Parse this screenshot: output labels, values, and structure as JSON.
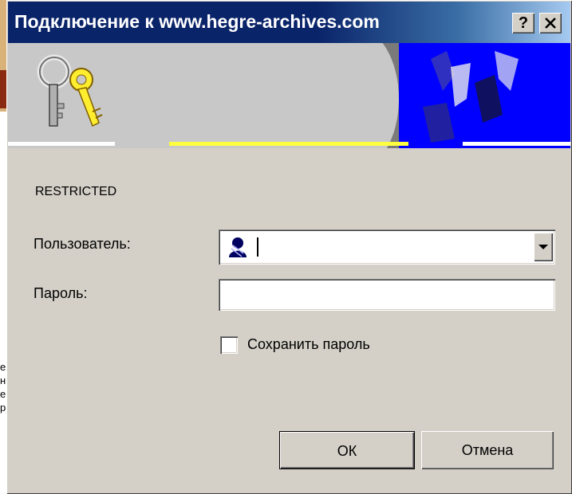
{
  "background_window": {
    "edge_letters": [
      "e",
      "н",
      "e",
      "р"
    ]
  },
  "dialog": {
    "title": "Подключение к www.hegre-archives.com",
    "help_button": "?",
    "close_button": "✕",
    "realm": "RESTRICTED",
    "user_label": "Пользователь:",
    "user_value": "",
    "password_label": "Пароль:",
    "password_value": "",
    "remember_label": "Сохранить пароль",
    "remember_checked": false,
    "ok_label": "ОК",
    "cancel_label": "Отмена"
  },
  "colors": {
    "titlebar": "#0a246a",
    "face": "#d4d0c8",
    "banner_blue": "#0000ff",
    "banner_yellow": "#ffff40"
  }
}
